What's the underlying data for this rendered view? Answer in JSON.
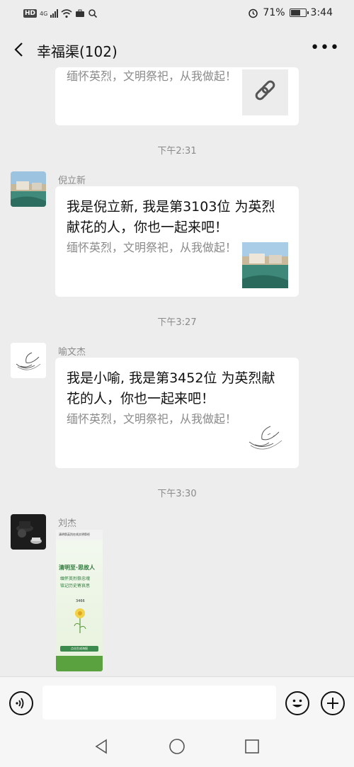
{
  "status": {
    "network_badge": "HD",
    "signal_label": "4G",
    "battery_percent_text": "71%",
    "battery_level": 0.71,
    "time": "3:44"
  },
  "header": {
    "back_icon": "chevron-left-icon",
    "title": "幸福渠(102)",
    "more_icon": "more-dots-icon"
  },
  "messages": [
    {
      "type": "link-card-partial",
      "desc": "缅怀英烈，文明祭祀，从我做起！",
      "thumb_icon": "link-icon"
    },
    {
      "type": "time",
      "text": "下午2:31"
    },
    {
      "type": "link-card",
      "sender": "倪立新",
      "title": "我是倪立新, 我是第3103位 为英烈献花的人，你也一起来吧！",
      "desc": "缅怀英烈，文明祭祀，从我做起！"
    },
    {
      "type": "time",
      "text": "下午3:27"
    },
    {
      "type": "link-card",
      "sender": "喻文杰",
      "title": "我是小喻, 我是第3452位 为英烈献花的人，你也一起来吧！",
      "desc": "缅怀英烈，文明祭祀，从我做起！"
    },
    {
      "type": "time",
      "text": "下午3:30"
    },
    {
      "type": "image",
      "sender": "刘杰",
      "screenshot": {
        "top_title": "清明祭英烈在线文明祭祀",
        "headline": "清明至·思故人",
        "line1": "缅怀英烈祭忠魂",
        "line2": "铭记历史寄哀思",
        "count": "3466",
        "footer_btn": "点击生成海报"
      }
    }
  ],
  "input": {
    "voice_icon": "voice-icon",
    "emoji_icon": "emoji-icon",
    "plus_icon": "plus-icon",
    "placeholder": ""
  },
  "nav": {
    "back_icon": "nav-back-icon",
    "home_icon": "nav-home-icon",
    "recent_icon": "nav-recent-icon"
  },
  "colors": {
    "background": "#ededed",
    "bubble": "#ffffff",
    "muted_text": "#8a8a8a"
  }
}
